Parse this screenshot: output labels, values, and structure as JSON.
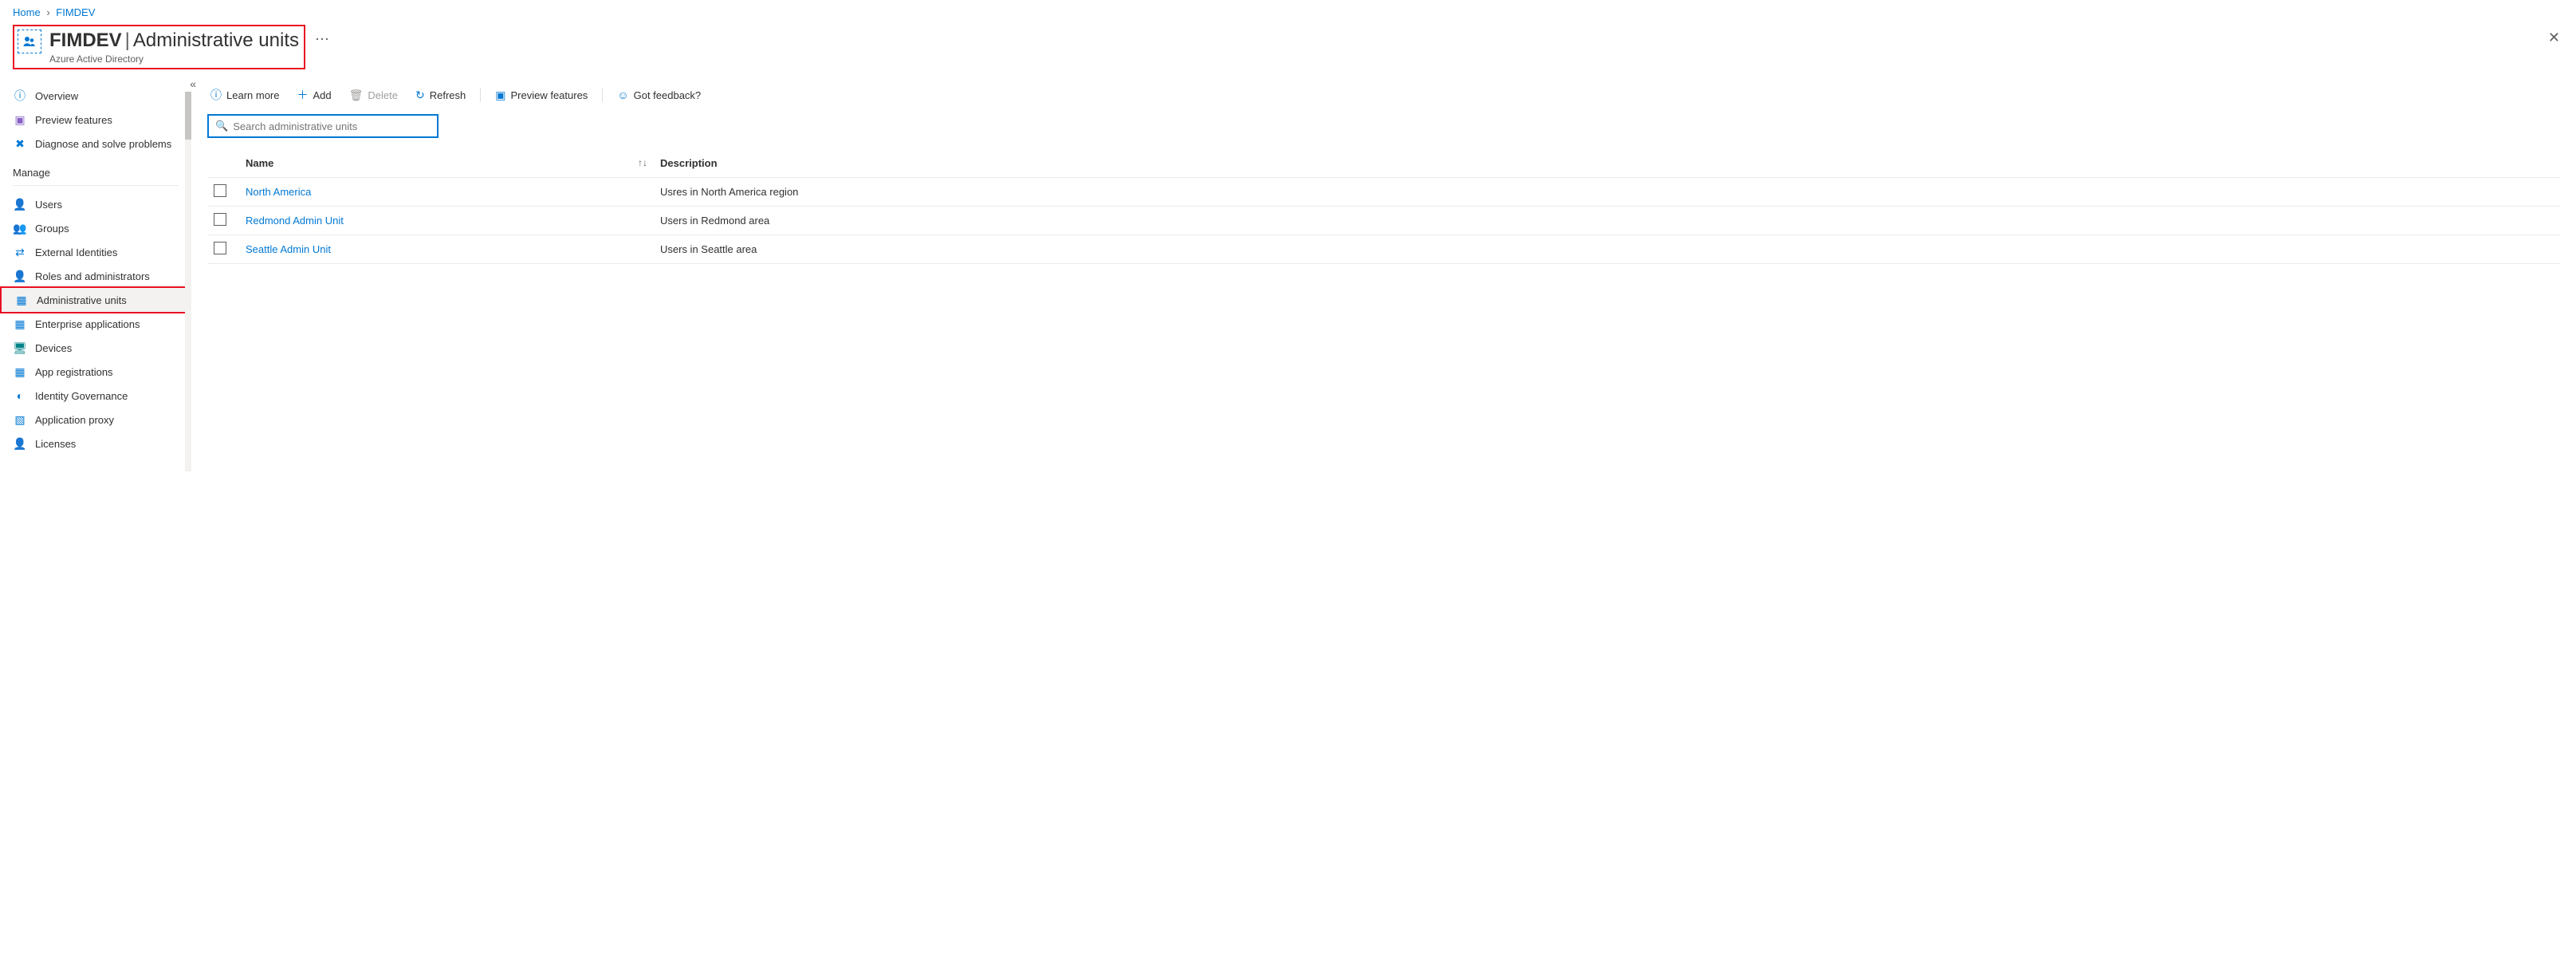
{
  "breadcrumb": {
    "home": "Home",
    "item": "FIMDEV"
  },
  "header": {
    "tenant": "FIMDEV",
    "section": "Administrative units",
    "subtitle": "Azure Active Directory"
  },
  "sidebar": {
    "top": [
      {
        "label": "Overview",
        "icon": "info-icon",
        "cls": "ic-blue"
      },
      {
        "label": "Preview features",
        "icon": "preview-icon",
        "cls": "ic-purple"
      },
      {
        "label": "Diagnose and solve problems",
        "icon": "diagnose-icon",
        "cls": "ic-blue"
      }
    ],
    "manage_label": "Manage",
    "manage": [
      {
        "label": "Users",
        "icon": "user-icon",
        "cls": "ic-blue"
      },
      {
        "label": "Groups",
        "icon": "group-icon",
        "cls": "ic-blue"
      },
      {
        "label": "External Identities",
        "icon": "external-icon",
        "cls": "ic-blue"
      },
      {
        "label": "Roles and administrators",
        "icon": "roles-icon",
        "cls": "ic-green"
      },
      {
        "label": "Administrative units",
        "icon": "adminunits-icon",
        "cls": "ic-blue",
        "selected": true
      },
      {
        "label": "Enterprise applications",
        "icon": "entapps-icon",
        "cls": "ic-blue"
      },
      {
        "label": "Devices",
        "icon": "devices-icon",
        "cls": "ic-teal"
      },
      {
        "label": "App registrations",
        "icon": "appreg-icon",
        "cls": "ic-blue"
      },
      {
        "label": "Identity Governance",
        "icon": "idgov-icon",
        "cls": "ic-blue"
      },
      {
        "label": "Application proxy",
        "icon": "appproxy-icon",
        "cls": "ic-blue"
      },
      {
        "label": "Licenses",
        "icon": "licenses-icon",
        "cls": "ic-green"
      }
    ]
  },
  "toolbar": {
    "learn": "Learn more",
    "add": "Add",
    "delete": "Delete",
    "refresh": "Refresh",
    "preview": "Preview features",
    "feedback": "Got feedback?"
  },
  "search": {
    "placeholder": "Search administrative units"
  },
  "table": {
    "headers": {
      "name": "Name",
      "description": "Description"
    },
    "rows": [
      {
        "name": "North America",
        "description": "Usres in North America region"
      },
      {
        "name": "Redmond Admin Unit",
        "description": "Users in Redmond area"
      },
      {
        "name": "Seattle Admin Unit",
        "description": "Users in Seattle area"
      }
    ]
  }
}
